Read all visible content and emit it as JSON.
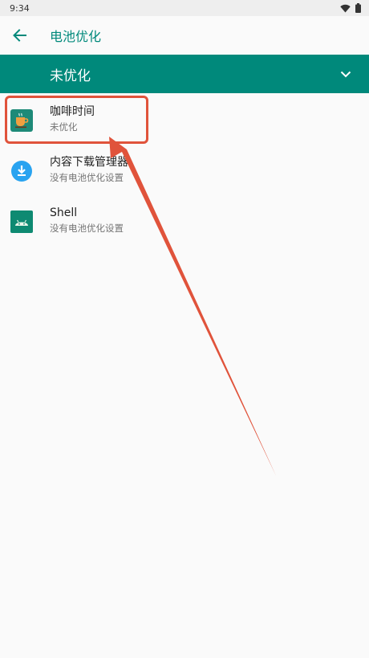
{
  "status_bar": {
    "time": "9:34",
    "wifi_icon": "wifi-icon",
    "battery_icon": "battery-icon"
  },
  "app_bar": {
    "title": "电池优化",
    "back_icon": "arrow-back-icon"
  },
  "filter": {
    "label": "未优化",
    "dropdown_icon": "chevron-down-icon"
  },
  "apps": [
    {
      "name": "咖啡时间",
      "status": "未优化",
      "icon": "coffee-icon",
      "icon_bg": "#1e8a78"
    },
    {
      "name": "内容下载管理器",
      "status": "没有电池优化设置",
      "icon": "download-icon",
      "icon_bg": "#29a3f0"
    },
    {
      "name": "Shell",
      "status": "没有电池优化设置",
      "icon": "android-icon",
      "icon_bg": "#0e8a72"
    }
  ],
  "annotation_color": "#e0533b",
  "accent_color": "#00897b"
}
